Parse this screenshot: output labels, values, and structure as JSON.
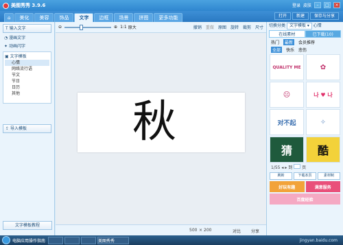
{
  "app": {
    "title": "美图秀秀 3.9.6",
    "title_right": [
      "登录",
      "皮肤"
    ]
  },
  "tabs": [
    "美化",
    "美容",
    "饰品",
    "文字",
    "边框",
    "场景",
    "拼图",
    "更多功能"
  ],
  "active_tab": "文字",
  "top_buttons": {
    "open": "打开",
    "new": "新建",
    "save": "保存与分享"
  },
  "left_panel": {
    "input_text": "输入文字",
    "bubble_text": "漫画文字",
    "animated_text": "动画闪字",
    "tree_title": "文字模板",
    "tree_items": [
      "心情",
      "网络流行语",
      "节文",
      "节日",
      "日历",
      "其他"
    ],
    "import_template": "导入模板",
    "bottom_link": "文字模板教程"
  },
  "toolbar": {
    "zoom_actual": "1:1",
    "zoom_original": "原大",
    "undo": "撤销",
    "redo": "重做",
    "original": "原图",
    "rotate": "旋转",
    "crop": "裁剪",
    "size": "尺寸"
  },
  "canvas": {
    "text": "秋",
    "size_w": "500",
    "size_h": "200"
  },
  "statusbar": {
    "size_x": "×",
    "compare": "对比",
    "share": "分享"
  },
  "right_panel": {
    "switch_label": "切换分类",
    "category": "文字模板",
    "category_sub": "心情",
    "tabs": [
      "在线素材",
      "已下载(10)"
    ],
    "sub_tabs": [
      "热门",
      "最新",
      "会员推荐"
    ],
    "filters": [
      "全部",
      "快乐",
      "悲伤"
    ],
    "page": "1/55",
    "page_sep": "到",
    "page_go": "页",
    "refresh": "刷新",
    "download_page": "下载本页",
    "material": "素材制",
    "ads": [
      "好玩有趣",
      "满意服务",
      "百度经验"
    ],
    "thumbs": [
      "QUALITY ME",
      "",
      "",
      "나 ♥ 나",
      "对不起",
      "",
      "猜",
      "酷"
    ]
  },
  "taskbar": {
    "app": "美图秀秀",
    "watermark": "jingyan.baidu.com",
    "left_hint": "电脑应用操作指南"
  }
}
